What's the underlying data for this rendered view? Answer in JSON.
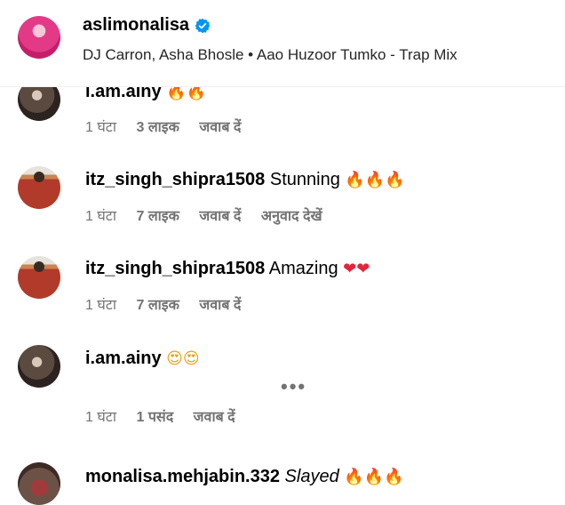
{
  "header": {
    "username": "aslimonalisa",
    "music": "DJ Carron, Asha Bhosle • Aao Huzoor Tumko - Trap Mix"
  },
  "comments": [
    {
      "username": "i.am.ainy",
      "text": "",
      "emoji": "🔥🔥",
      "time": "1 घंटा",
      "likes": "3 लाइक",
      "reply": "जवाब दें"
    },
    {
      "username": "itz_singh_shipra1508",
      "text": "Stunning",
      "emoji": "🔥🔥🔥",
      "time": "1 घंटा",
      "likes": "7 लाइक",
      "reply": "जवाब दें",
      "translate": "अनुवाद देखें"
    },
    {
      "username": "itz_singh_shipra1508",
      "text": "Amazing",
      "emoji": "❤❤",
      "time": "1 घंटा",
      "likes": "7 लाइक",
      "reply": "जवाब दें"
    },
    {
      "username": "i.am.ainy",
      "text": "",
      "emoji": "😍😍",
      "more": "•••",
      "time": "1 घंटा",
      "likes": "1 पसंद",
      "reply": "जवाब दें"
    },
    {
      "username": "monalisa.mehjabin.332",
      "text": "Slayed",
      "emoji": "🔥🔥🔥"
    }
  ]
}
